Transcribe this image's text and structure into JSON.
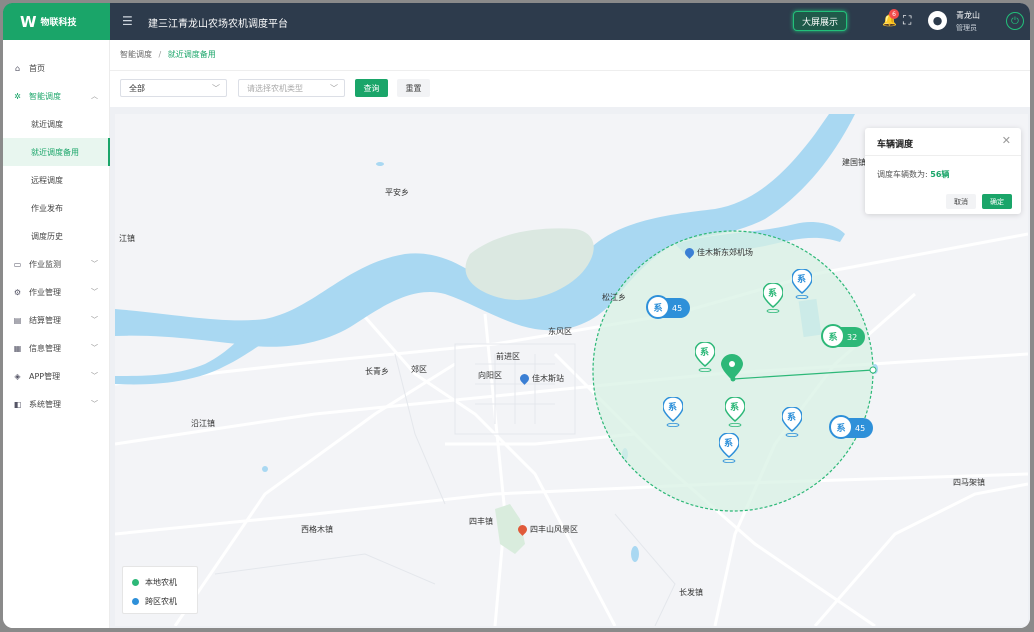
{
  "header": {
    "logo_text": "物联科技",
    "logo_mark": "W",
    "system_title": "建三江青龙山农场农机调度平台",
    "big_screen_label": "大屏展示",
    "notification_count": "6",
    "user_name": "青龙山",
    "user_role": "管理员"
  },
  "sidebar": {
    "items": [
      {
        "label": "首页"
      },
      {
        "label": "智能调度"
      },
      {
        "label": "作业监测"
      },
      {
        "label": "作业管理"
      },
      {
        "label": "结算管理"
      },
      {
        "label": "信息管理"
      },
      {
        "label": "APP管理"
      },
      {
        "label": "系统管理"
      }
    ],
    "sub_items": [
      {
        "label": "就近调度"
      },
      {
        "label": "就近调度备用"
      },
      {
        "label": "远程调度"
      },
      {
        "label": "作业发布"
      },
      {
        "label": "调度历史"
      }
    ]
  },
  "breadcrumb": {
    "parent": "智能调度",
    "separator": "/",
    "current": "就近调度备用"
  },
  "filters": {
    "region_value": "全部",
    "machine_type_placeholder": "请选择农机类型",
    "query_label": "查询",
    "reset_label": "重置"
  },
  "map": {
    "places": [
      "平安乡",
      "江镇",
      "建国镇",
      "松江乡",
      "东风区",
      "前进区",
      "向阳区",
      "郊区",
      "长青乡",
      "沿江镇",
      "西格木镇",
      "四丰镇",
      "长发镇",
      "四马架镇"
    ],
    "pois": [
      "佳木斯东郊机场",
      "佳木斯站",
      "四丰山风景区"
    ],
    "marker_glyph": "系",
    "clusters": [
      "45",
      "32",
      "45"
    ],
    "colors": {
      "local": "#2db878",
      "cross_region": "#2e90d9",
      "river": "#a9d8f2",
      "range_fill": "#d8f1e4"
    }
  },
  "dialog": {
    "title": "车辆调度",
    "count_label": "调度车辆数为:",
    "count_value": "56辆",
    "cancel_label": "取消",
    "confirm_label": "确定"
  },
  "legend": {
    "local": "本地农机",
    "cross_region": "跨区农机"
  }
}
